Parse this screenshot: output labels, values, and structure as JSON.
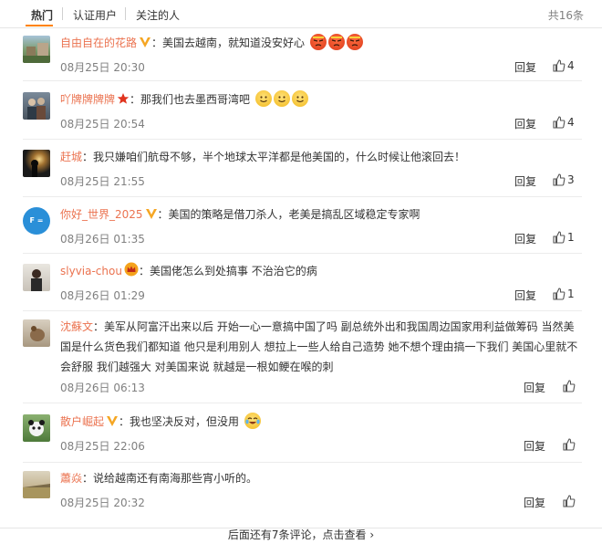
{
  "tabs": {
    "hot": "热门",
    "verified": "认证用户",
    "following": "关注的人",
    "total": "共16条"
  },
  "actions": {
    "reply_label": "回复"
  },
  "colors": {
    "accent": "#ff8200",
    "username": "#eb7350",
    "muted": "#808080"
  },
  "comments": [
    {
      "user": "自由自在的花路",
      "badge": "v-gold-icon",
      "text": "：美国去越南，就知道没安好心",
      "emojis": [
        "angry-face-icon",
        "angry-face-icon",
        "angry-face-icon"
      ],
      "time": "08月25日 20:30",
      "likes": "4"
    },
    {
      "user": "吖牌牌牌牌",
      "badge": "red-star-icon",
      "text": "：那我们也去墨西哥湾吧",
      "emojis": [
        "smile-face-icon",
        "smile-face-icon",
        "smile-face-icon"
      ],
      "time": "08月25日 20:54",
      "likes": "4"
    },
    {
      "user": "赶城",
      "text": "：我只嫌咱们航母不够，半个地球太平洋都是他美国的，什么时候让他滚回去！",
      "time": "08月25日 21:55",
      "likes": "3"
    },
    {
      "user": "你好_世界_2025",
      "badge": "v-gold-icon",
      "text": "：美国的策略是借刀杀人，老美是搞乱区域稳定专家啊",
      "avatar_text": "F = ma",
      "time": "08月26日 01:35",
      "likes": "1"
    },
    {
      "user": "slyvia-chou",
      "badge": "crown-icon",
      "text": "：美国佬怎么到处搞事 不治治它的病",
      "time": "08月26日 01:29",
      "likes": "1"
    },
    {
      "user": "沈蘇文",
      "text": "：美军从阿富汗出来以后 开始一心一意搞中国了吗 副总统外出和我国周边国家用利益做筹码 当然美国是什么货色我们都知道 他只是利用别人 想拉上一些人给自己造势 她不想个理由搞一下我们 美国心里就不会舒服 我们越强大 对美国来说 就越是一根如鲠在喉的刺",
      "time": "08月26日 06:13",
      "likes": ""
    },
    {
      "user": "散户崛起",
      "badge": "v-gold-icon",
      "text": "：我也坚决反对，但没用",
      "emojis": [
        "laugh-cry-icon"
      ],
      "time": "08月25日 22:06",
      "likes": ""
    },
    {
      "user": "蕭焱",
      "text": "：说给越南还有南海那些宵小听的。",
      "time": "08月25日 20:32",
      "likes": ""
    }
  ],
  "footer": {
    "more": "后面还有7条评论，点击查看 ›"
  }
}
